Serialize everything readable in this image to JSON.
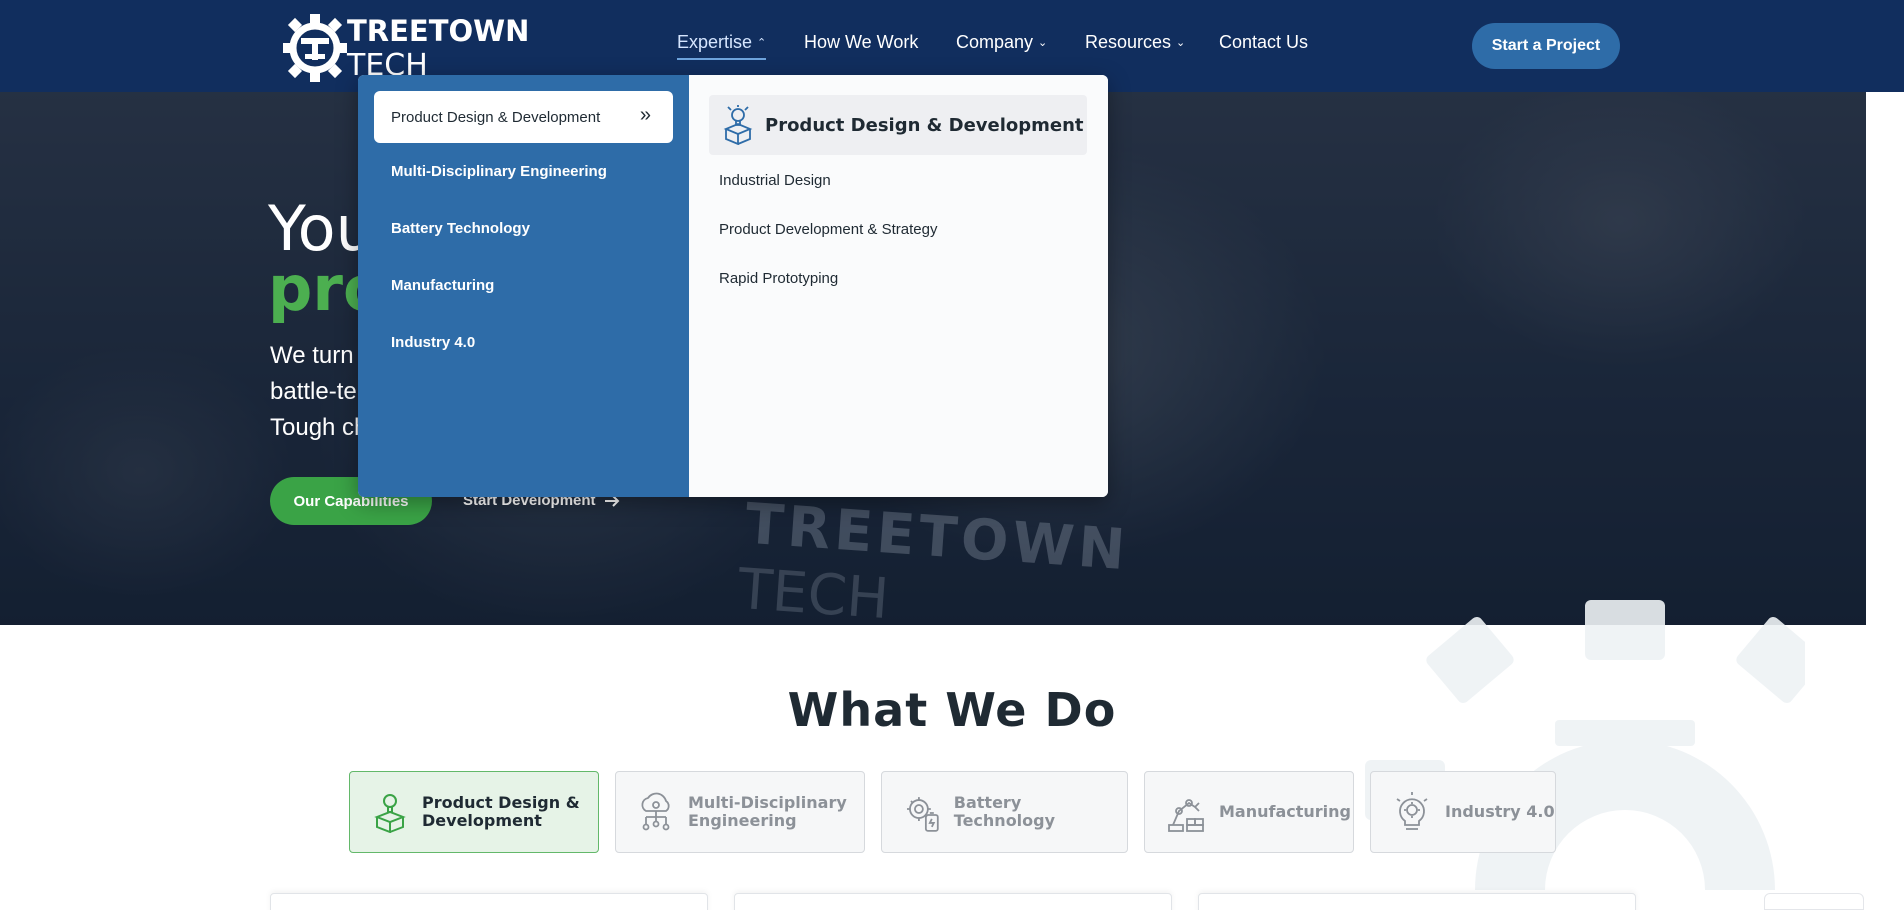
{
  "header": {
    "logo_line_1": "TREETOWN",
    "logo_line_2": "TECH",
    "nav": [
      {
        "label": "Expertise",
        "has_dropdown": true,
        "active": true
      },
      {
        "label": "How We Work",
        "has_dropdown": false
      },
      {
        "label": "Company",
        "has_dropdown": true
      },
      {
        "label": "Resources",
        "has_dropdown": true
      },
      {
        "label": "Contact Us",
        "has_dropdown": false
      }
    ],
    "cta": "Start a Project"
  },
  "hero": {
    "title_line_1": "You",
    "title_line_2": "pro",
    "subtitle_lines": [
      "We turn",
      "battle-te",
      "Tough ch"
    ],
    "primary_button": "Our Capabilities",
    "secondary_link": "Start Development",
    "watermark_1": "TREETOWN",
    "watermark_2": "TECH"
  },
  "mega_menu": {
    "categories": [
      {
        "label": "Product Design & Development",
        "selected": true
      },
      {
        "label": "Multi-Disciplinary Engineering"
      },
      {
        "label": "Battery Technology"
      },
      {
        "label": "Manufacturing"
      },
      {
        "label": "Industry 4.0"
      }
    ],
    "panel": {
      "title": "Product Design & Development",
      "icon": "box-lightbulb-icon",
      "links": [
        "Industrial Design",
        "Product Development & Strategy",
        "Rapid Prototyping"
      ]
    }
  },
  "what_we_do": {
    "title": "What We Do",
    "tabs": [
      {
        "label_1": "Product Design &",
        "label_2": "Development",
        "icon": "box-lightbulb-icon",
        "active": true
      },
      {
        "label_1": "Multi-Disciplinary",
        "label_2": "Engineering",
        "icon": "cloud-network-icon"
      },
      {
        "label_1": "Battery Technology",
        "label_2": "",
        "icon": "gear-battery-icon"
      },
      {
        "label_1": "Manufacturing",
        "label_2": "",
        "icon": "robot-arm-icon"
      },
      {
        "label_1": "Industry 4.0",
        "label_2": "",
        "icon": "lightbulb-gear-icon"
      }
    ]
  },
  "colors": {
    "header_bg": "#112e5e",
    "accent_blue": "#2e6ca8",
    "accent_green": "#3aa346",
    "headline_green": "#4caf50"
  }
}
